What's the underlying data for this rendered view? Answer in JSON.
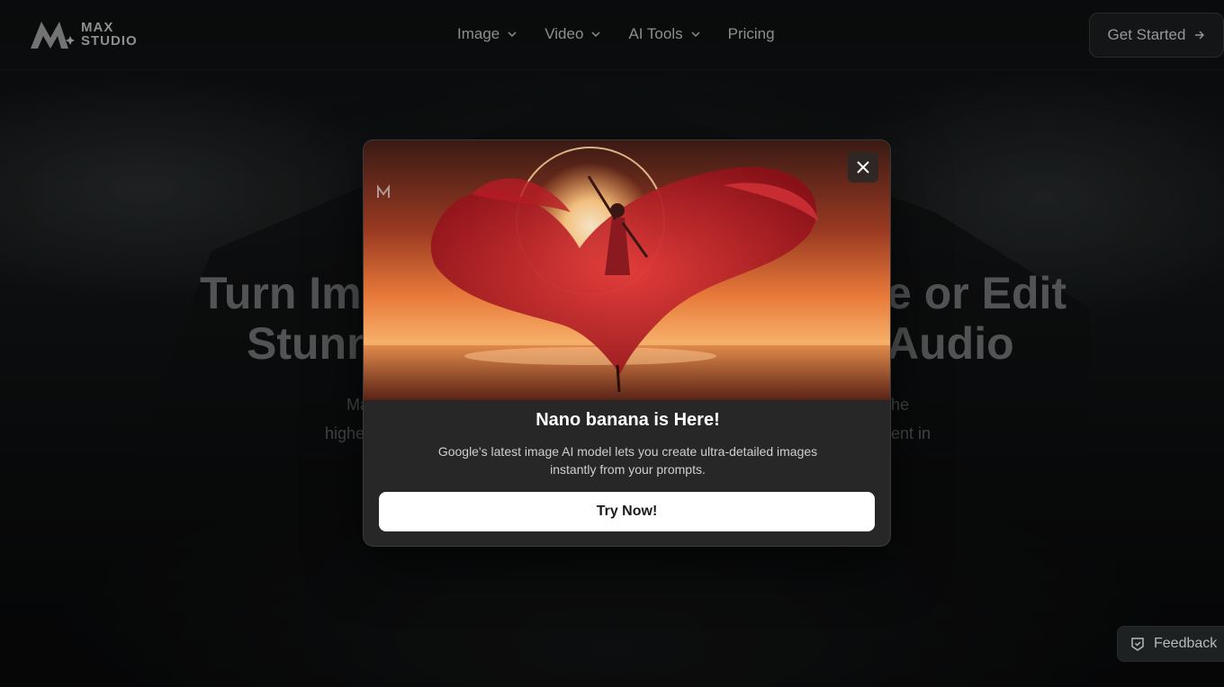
{
  "header": {
    "logo_line1": "MAX",
    "logo_line2": "STUDIO",
    "nav": [
      {
        "label": "Image",
        "has_dropdown": true,
        "icon": "chevron-down-icon"
      },
      {
        "label": "Video",
        "has_dropdown": true,
        "icon": "chevron-down-icon"
      },
      {
        "label": "AI Tools",
        "has_dropdown": true,
        "icon": "chevron-down-icon"
      },
      {
        "label": "Pricing",
        "has_dropdown": false
      }
    ],
    "cta_label": "Get Started",
    "cta_icon": "arrow-right-icon"
  },
  "hero": {
    "title_line1_left": "Turn Im",
    "title_line1_right": "e or Edit",
    "title_line2_left": "Stunn",
    "title_line2_right": "Audio",
    "sub_line1_left": "Ma",
    "sub_line1_right": "he",
    "sub_line2_left": "highe",
    "sub_line2_right": "ent in"
  },
  "modal": {
    "close_icon": "close-icon",
    "title": "Nano banana is Here!",
    "description": "Google's latest image AI model lets you create ultra-detailed images instantly from your prompts.",
    "button_label": "Try Now!"
  },
  "feedback": {
    "label": "Feedback",
    "icon": "feedback-icon"
  },
  "colors": {
    "background": "#0d0f10",
    "modal_bg": "#272727",
    "button_bg": "#ffffff",
    "sunset_red": "#c8202a",
    "sunset_orange": "#f29a4a"
  }
}
